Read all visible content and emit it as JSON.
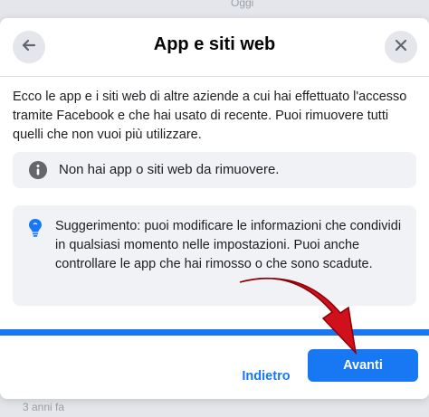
{
  "background": {
    "top_text": "Oggi",
    "bottom_text": "3 anni fa"
  },
  "dialog": {
    "title": "App e siti web",
    "description": "Ecco le app e i siti web di altre aziende a cui hai effettuato l'accesso tramite Facebook e che hai usato di recente. Puoi rimuovere tutti quelli che non vuoi più utilizzare.",
    "info_message": "Non hai app o siti web da rimuovere.",
    "tip_message": "Suggerimento: puoi modificare le informazioni che condividi in qualsiasi momento nelle impostazioni. Puoi anche controllare le app che hai rimosso o che sono scadute.",
    "back_label": "Indietro",
    "next_label": "Avanti"
  },
  "icons": {
    "back": "back-arrow-icon",
    "close": "close-icon",
    "info": "info-icon",
    "tip": "lightbulb-icon",
    "annotation": "red-arrow-annotation"
  },
  "colors": {
    "accent": "#1877f2",
    "annotation": "#d0101a",
    "panel": "#f0f2f5"
  }
}
